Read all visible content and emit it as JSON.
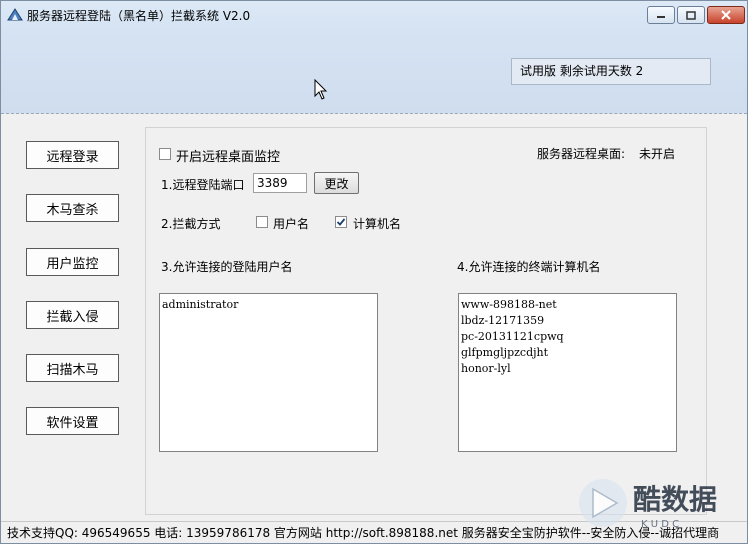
{
  "window": {
    "title": "服务器远程登陆（黑名单）拦截系统 V2.0",
    "trial_text": "试用版 剩余试用天数 2"
  },
  "sidebar": {
    "items": [
      {
        "label": "远程登录"
      },
      {
        "label": "木马查杀"
      },
      {
        "label": "用户监控"
      },
      {
        "label": "拦截入侵"
      },
      {
        "label": "扫描木马"
      },
      {
        "label": "软件设置"
      }
    ]
  },
  "main": {
    "enable_monitor_label": "开启远程桌面监控",
    "enable_monitor_checked": false,
    "status_label": "服务器远程桌面:",
    "status_value": "未开启",
    "port_label": "1.远程登陆端口",
    "port_value": "3389",
    "change_button": "更改",
    "block_mode_label": "2.拦截方式",
    "block_by_username_label": "用户名",
    "block_by_username_checked": false,
    "block_by_computer_label": "计算机名",
    "block_by_computer_checked": true,
    "allowed_users_label": "3.允许连接的登陆用户名",
    "allowed_users": [
      "administrator"
    ],
    "allowed_computers_label": "4.允许连接的终端计算机名",
    "allowed_computers": [
      "www-898188-net",
      "lbdz-12171359",
      "pc-20131121cpwq",
      "glfpmgljpzcdjht",
      "honor-lyl"
    ]
  },
  "statusbar": {
    "text": "技术支持QQ: 496549655   电话: 13959786178   官方网站 http://soft.898188.net 服务器安全宝防护软件--安全防入侵--诚招代理商"
  },
  "watermark": {
    "text": "酷数据",
    "sub": "K U D C"
  },
  "colors": {
    "titlebar": "#d5e3f3",
    "close_button": "#c7432a",
    "window_bg": "#f0f0f0"
  }
}
